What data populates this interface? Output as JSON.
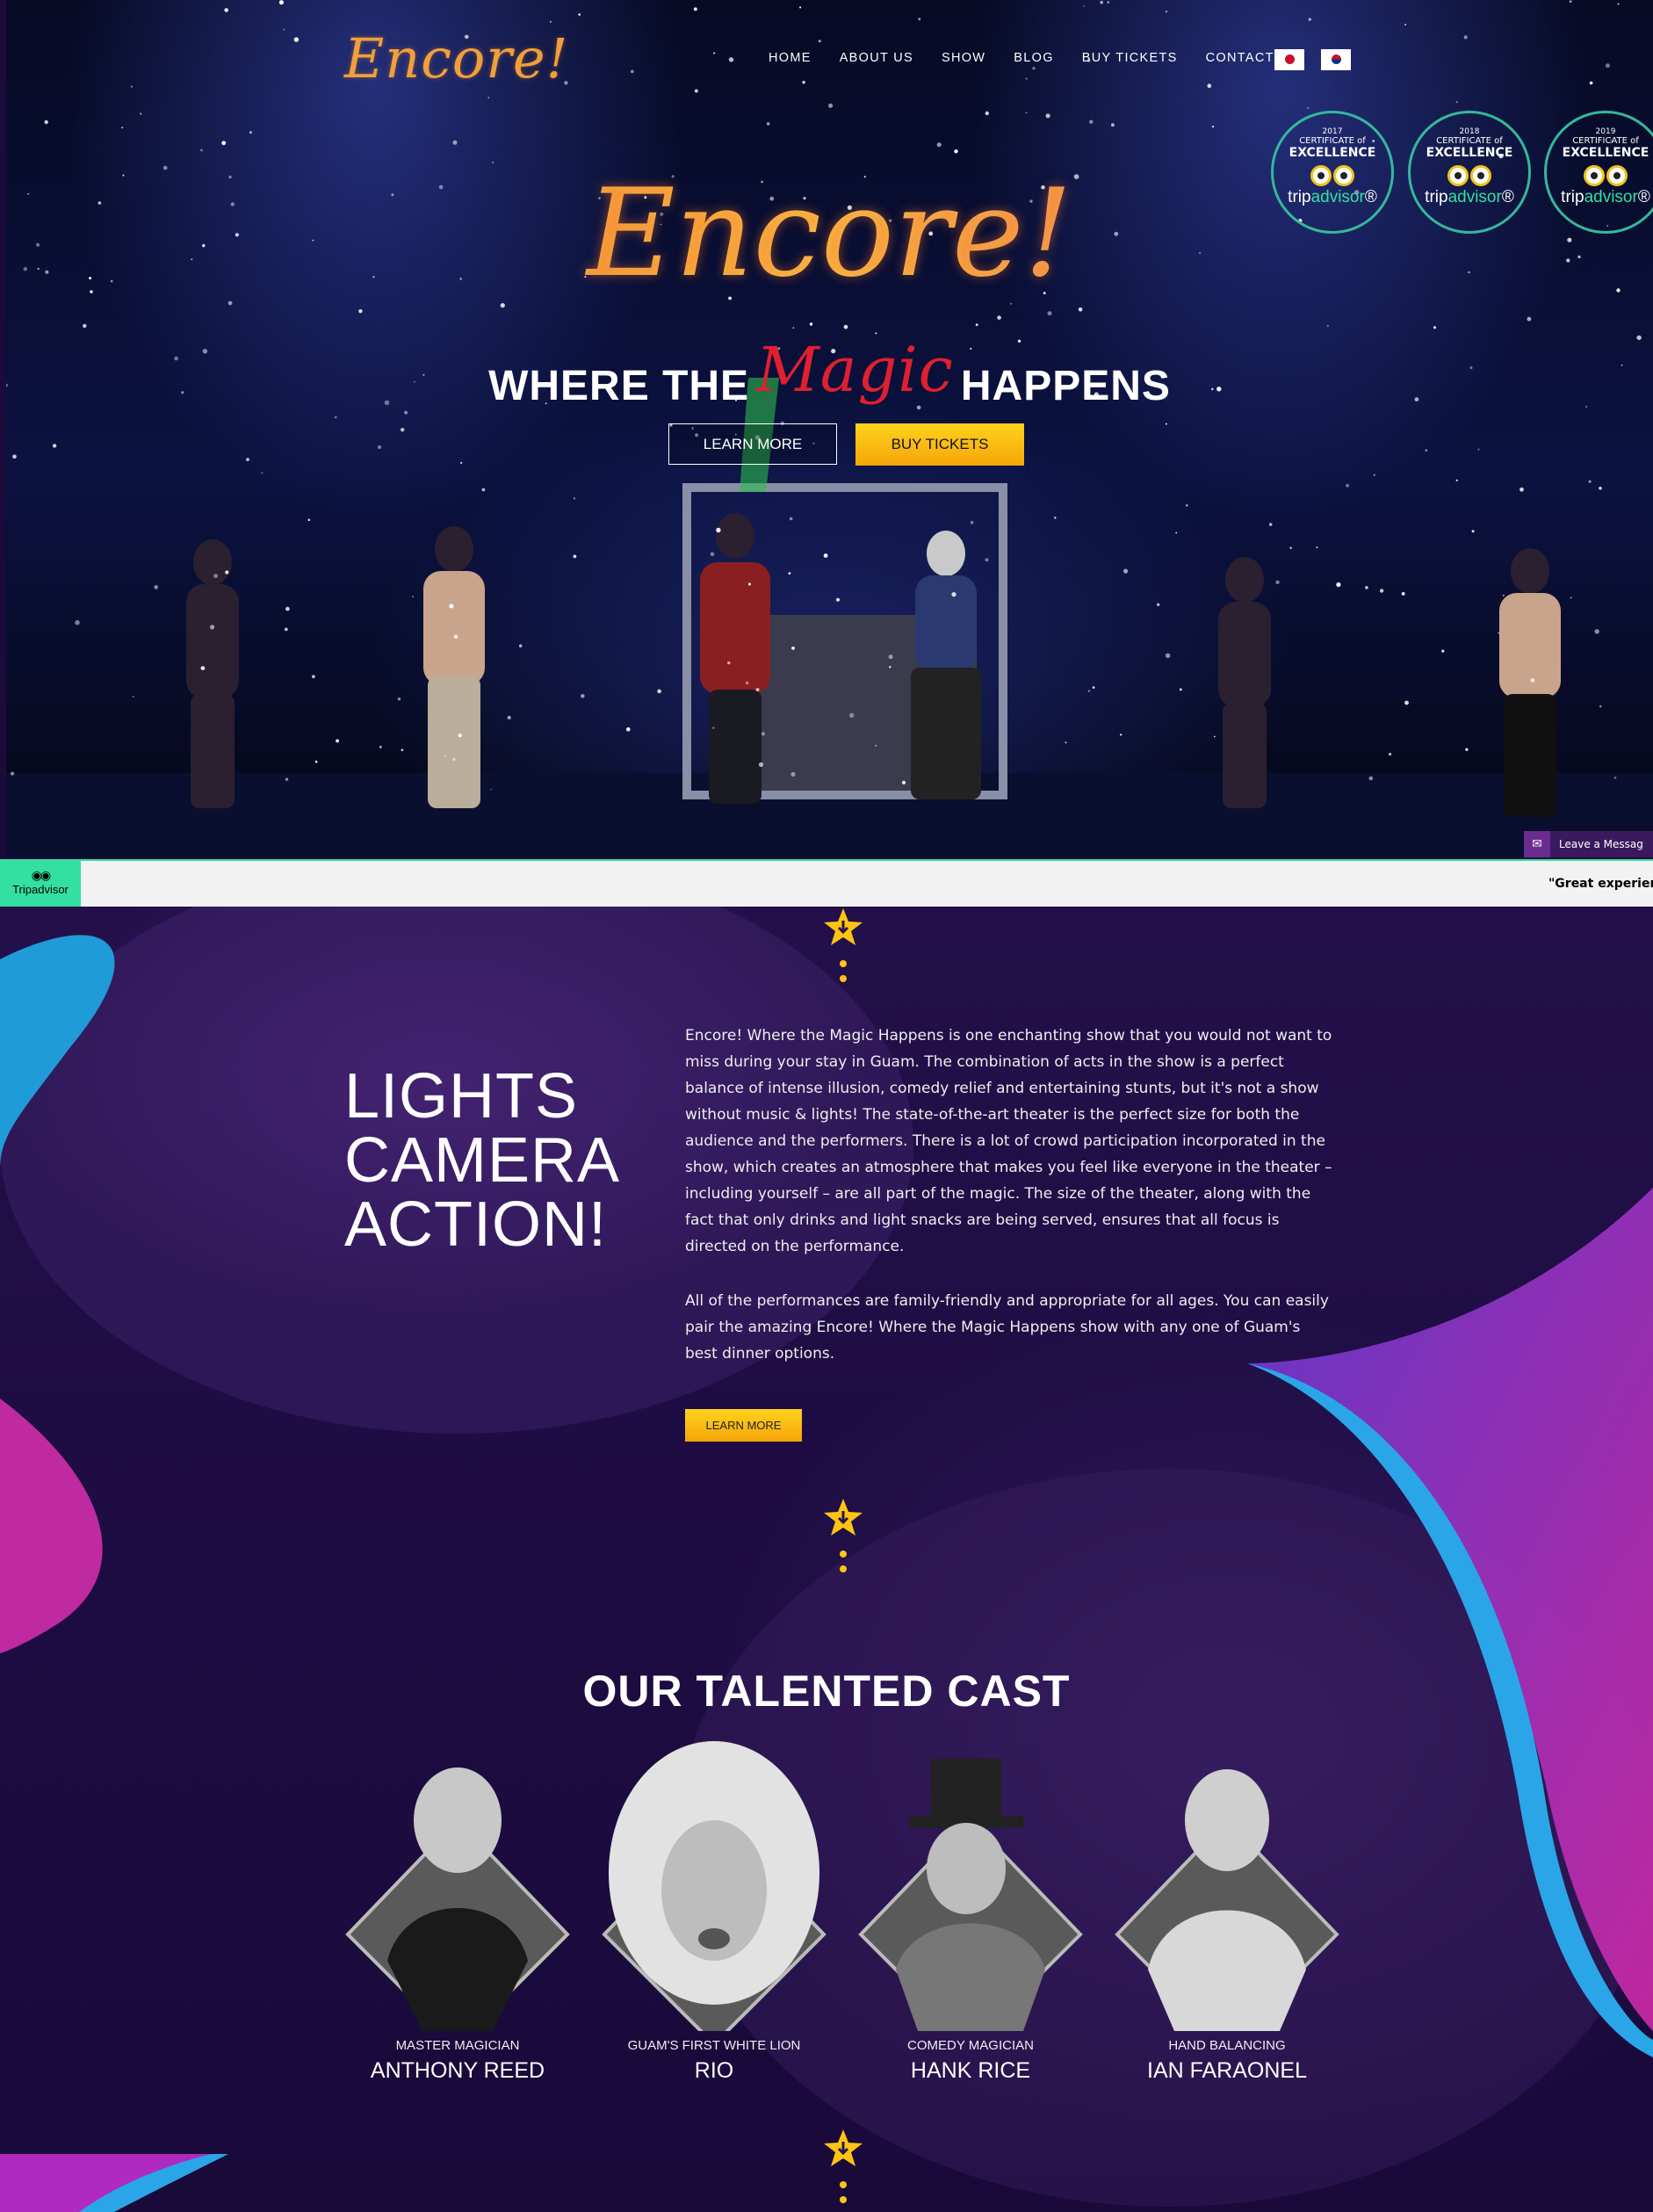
{
  "brand": {
    "logo_text": "Encore!"
  },
  "nav": {
    "items": [
      {
        "label": "HOME"
      },
      {
        "label": "ABOUT US"
      },
      {
        "label": "SHOW"
      },
      {
        "label": "BLOG"
      },
      {
        "label": "BUY TICKETS"
      },
      {
        "label": "CONTACT US"
      }
    ],
    "flags": [
      "japan-flag-icon",
      "korea-flag-icon"
    ]
  },
  "badges": [
    {
      "year": "2017",
      "certificate": "CERTIFICATE of",
      "excellence": "EXCELLENCE",
      "brand_a": "trip",
      "brand_b": "advisor",
      "mark": "®"
    },
    {
      "year": "2018",
      "certificate": "CERTIFICATE of",
      "excellence": "EXCELLENCE",
      "brand_a": "trip",
      "brand_b": "advisor",
      "mark": "®"
    },
    {
      "year": "2019",
      "certificate": "CERTIFICATE of",
      "excellence": "EXCELLENCE",
      "brand_a": "trip",
      "brand_b": "advisor",
      "mark": "®"
    }
  ],
  "hero": {
    "title": "Encore!",
    "tagline_left": "WHERE THE",
    "tagline_magic": "Magic",
    "tagline_right": "HAPPENS",
    "learn_more": "LEARN MORE",
    "buy_tickets": "BUY TICKETS"
  },
  "chat": {
    "label": "Leave a Messag"
  },
  "tripadvisor_bar": {
    "logo_label": "Tripadvisor",
    "quote": "\"Great experienc"
  },
  "about": {
    "heading_lines": [
      "LIGHTS",
      "CAMERA",
      "ACTION!"
    ],
    "paragraph_1": "Encore! Where the Magic Happens is one enchanting show that you would not want to miss during your stay in Guam. The combination of acts in the show is a perfect balance of intense illusion, comedy relief and entertaining stunts, but it's not a show without music & lights! The state-of-the-art theater is the perfect size for both the audience and the performers. There is a lot of crowd participation incorporated in the show, which creates an atmosphere that makes you feel like everyone in the theater – including yourself – are all part of the magic. The size of the theater, along with the fact that only drinks and light snacks are being served, ensures that all focus is directed on the performance.",
    "paragraph_2": "All of the performances are family-friendly and appropriate for all ages. You can easily pair the amazing Encore! Where the Magic Happens show with any one of Guam's best dinner options.",
    "learn_more": "LEARN MORE"
  },
  "cast": {
    "title": "OUR TALENTED CAST",
    "members": [
      {
        "role": "MASTER MAGICIAN",
        "name": "ANTHONY REED"
      },
      {
        "role": "GUAM'S FIRST WHITE LION",
        "name": "RIO"
      },
      {
        "role": "COMEDY MAGICIAN",
        "name": "HANK RICE"
      },
      {
        "role": "HAND BALANCING",
        "name": "IAN FARAONEL"
      }
    ]
  },
  "colors": {
    "accent": "#ffc412",
    "tripadvisor": "#34e0a1",
    "magic_red": "#e0202e",
    "bg_purple": "#1d0c42"
  }
}
